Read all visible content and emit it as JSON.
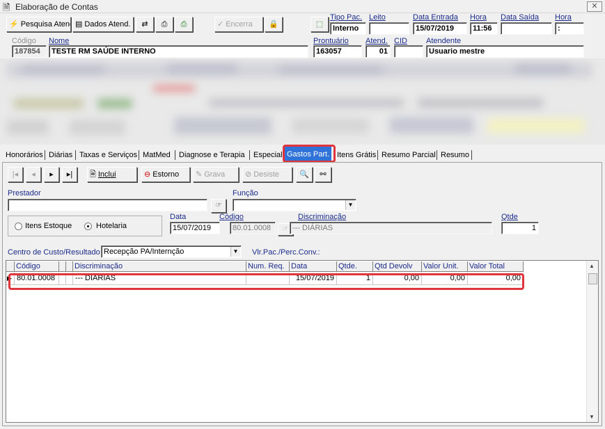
{
  "window": {
    "title": "Elaboração de Contas",
    "close": "✕"
  },
  "toolbar": {
    "pesquisa_atend": "Pesquisa Atend.",
    "dados_atend": "Dados Atend.",
    "encerra": "Encerra"
  },
  "header": {
    "tipo_pac_label": "Tipo Pac.",
    "tipo_pac": "Interno",
    "leito_label": "Leito",
    "leito": "",
    "data_entrada_label": "Data Entrada",
    "data_entrada": "15/07/2019",
    "hora_label": "Hora",
    "hora": "11:56",
    "data_saida_label": "Data Saída",
    "data_saida": "",
    "hora2_label": "Hora",
    "hora2": ":",
    "codigo_label": "Código",
    "codigo": "187854",
    "nome_label": "Nome",
    "nome": "TESTE RM SAÚDE INTERNO",
    "prontuario_label": "Prontuário",
    "prontuario": "163057",
    "atend_label": "Atend.",
    "atend": "01",
    "cid_label": "CID",
    "cid": "",
    "atendente_label": "Atendente",
    "atendente": "Usuario mestre"
  },
  "tabs": [
    {
      "label": "Honorários"
    },
    {
      "label": "Diárias"
    },
    {
      "label": "Taxas e Serviços"
    },
    {
      "label": "MatMed"
    },
    {
      "label": "Diagnose e Terapia"
    },
    {
      "label": "Especial"
    },
    {
      "label": "Gastos Part."
    },
    {
      "label": "Itens Grátis"
    },
    {
      "label": "Resumo Parcial"
    },
    {
      "label": "Resumo"
    }
  ],
  "active_tab": "Gastos Part.",
  "nav": {
    "inclui": "Inclui",
    "estorno": "Estorno",
    "grava": "Grava",
    "desiste": "Desiste"
  },
  "form": {
    "prestador_label": "Prestador",
    "prestador": "",
    "funcao_label": "Função",
    "funcao": "",
    "itens_estoque": "Itens Estoque",
    "hotelaria": "Hotelaria",
    "data_label": "Data",
    "data": "15/07/2019",
    "codigo_label": "Código",
    "codigo": "80.01.0008",
    "discriminacao_label": "Discriminação",
    "discriminacao": "--- DIÁRIAS",
    "qtde_label": "Qtde",
    "qtde": "1",
    "centro_custo_label": "Centro de Custo/Resultado",
    "centro_custo": "Recepção PA/Internção",
    "vlr_pac_label": "Vlr.Pac./Perc.Conv.:"
  },
  "grid": {
    "headers": [
      "Código",
      "",
      "Discriminação",
      "Num. Req.",
      "Data",
      "Qtde.",
      "Qtd Devolv",
      "Valor Unit.",
      "Valor Total"
    ],
    "rows": [
      [
        "80.01.0008",
        "",
        "--- DIÁRIAS",
        "",
        "15/07/2019",
        "1",
        "0,00",
        "0,00",
        "0,00"
      ]
    ]
  }
}
